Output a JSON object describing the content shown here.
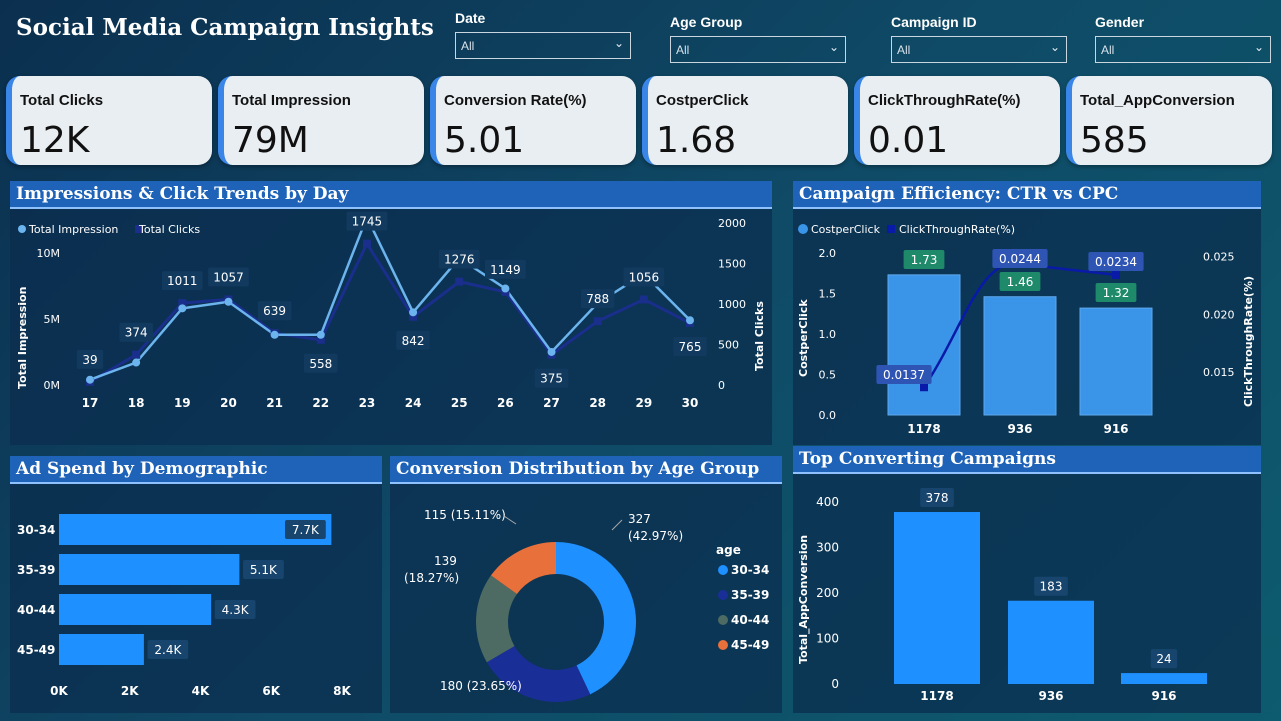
{
  "title": "Social Media Campaign Insights",
  "filters": [
    {
      "label": "Date",
      "value": "All"
    },
    {
      "label": "Age Group",
      "value": "All"
    },
    {
      "label": "Campaign ID",
      "value": "All"
    },
    {
      "label": "Gender",
      "value": "All"
    }
  ],
  "cards": [
    {
      "label": "Total Clicks",
      "value": "12K"
    },
    {
      "label": "Total Impression",
      "value": "79M"
    },
    {
      "label": "Conversion Rate(%)",
      "value": "5.01"
    },
    {
      "label": "CostperClick",
      "value": "1.68"
    },
    {
      "label": "ClickThroughRate(%)",
      "value": "0.01"
    },
    {
      "label": "Total_AppConversion",
      "value": "585"
    }
  ],
  "panels": {
    "trend": "Impressions & Click Trends by Day",
    "efficiency": "Campaign Efficiency: CTR vs CPC",
    "spend": "Ad Spend by Demographic",
    "distribution": "Conversion Distribution by Age Group",
    "top": "Top Converting Campaigns"
  },
  "colors": {
    "impression": "#6cb4ee",
    "clicks": "#1a2e8c",
    "bar": "#1e90ff",
    "cpcBar": "#3a95e8",
    "ctr": "#0a1aa8",
    "green": "#1f8a6a",
    "donut": [
      "#1e90ff",
      "#1a2e98",
      "#4d6b62",
      "#e8703a"
    ]
  },
  "chart_data": [
    {
      "type": "line",
      "title": "Impressions & Click Trends by Day",
      "x": [
        "17",
        "18",
        "19",
        "20",
        "21",
        "22",
        "23",
        "24",
        "25",
        "26",
        "27",
        "28",
        "29",
        "30"
      ],
      "series": [
        {
          "name": "Total Impression",
          "axis": "left",
          "values": [
            0.4,
            1.7,
            5.8,
            6.3,
            3.8,
            3.8,
            12.7,
            5.5,
            9.6,
            7.3,
            2.5,
            6.2,
            8.4,
            4.9
          ]
        },
        {
          "name": "Total Clicks",
          "axis": "right",
          "values": [
            39,
            374,
            1011,
            1057,
            639,
            558,
            1745,
            842,
            1276,
            1149,
            375,
            788,
            1056,
            765
          ]
        }
      ],
      "ylabel": "Total Impression",
      "y2label": "Total Clicks",
      "yticks": [
        "0M",
        "5M",
        "10M"
      ],
      "ylim": [
        0,
        14
      ],
      "y2ticks": [
        "0",
        "500",
        "1000",
        "1500",
        "2000"
      ],
      "y2lim": [
        0,
        2000
      ],
      "data_labels": [
        "39",
        "374",
        "1011",
        "1057",
        "639",
        "558",
        "1745",
        "842",
        "1276",
        "1149",
        "375",
        "788",
        "1056",
        "765"
      ]
    },
    {
      "type": "bar",
      "title": "Campaign Efficiency: CTR vs CPC",
      "categories": [
        "1178",
        "936",
        "916"
      ],
      "series": [
        {
          "name": "CostperClick",
          "axis": "left",
          "values": [
            1.73,
            1.46,
            1.32
          ]
        },
        {
          "name": "ClickThroughRate(%)",
          "axis": "right",
          "type": "line",
          "values": [
            0.0137,
            0.0244,
            0.0234
          ]
        }
      ],
      "ylabel": "CostperClick",
      "y2label": "ClickThroughRate(%)",
      "yticks": [
        "0.0",
        "0.5",
        "1.0",
        "1.5",
        "2.0"
      ],
      "ylim": [
        0,
        2
      ],
      "y2ticks": [
        "0.015",
        "0.020",
        "0.025"
      ],
      "y2lim": [
        0.0113,
        0.0253
      ],
      "cpc_labels": [
        "1.73",
        "1.46",
        "1.32"
      ],
      "ctr_labels": [
        "0.0137",
        "0.0244",
        "0.0234"
      ]
    },
    {
      "type": "bar",
      "orientation": "horizontal",
      "title": "Ad Spend by Demographic",
      "categories": [
        "30-34",
        "35-39",
        "40-44",
        "45-49"
      ],
      "values": [
        7.7,
        5.1,
        4.3,
        2.4
      ],
      "data_labels": [
        "7.7K",
        "5.1K",
        "4.3K",
        "2.4K"
      ],
      "xticks": [
        "0K",
        "2K",
        "4K",
        "6K",
        "8K"
      ],
      "xlim": [
        0,
        8
      ]
    },
    {
      "type": "pie",
      "title": "Conversion Distribution by Age Group",
      "legend_title": "age",
      "categories": [
        "30-34",
        "35-39",
        "40-44",
        "45-49"
      ],
      "values": [
        327,
        180,
        139,
        115
      ],
      "labels": [
        [
          "327",
          "(42.97%)"
        ],
        [
          "180 (23.65%)"
        ],
        [
          "139",
          "(18.27%)"
        ],
        [
          "115 (15.11%)"
        ]
      ]
    },
    {
      "type": "bar",
      "title": "Top Converting Campaigns",
      "categories": [
        "1178",
        "936",
        "916"
      ],
      "values": [
        378,
        183,
        24
      ],
      "data_labels": [
        "378",
        "183",
        "24"
      ],
      "ylabel": "Total_AppConversion",
      "yticks": [
        "0",
        "100",
        "200",
        "300",
        "400"
      ],
      "ylim": [
        0,
        400
      ]
    }
  ]
}
